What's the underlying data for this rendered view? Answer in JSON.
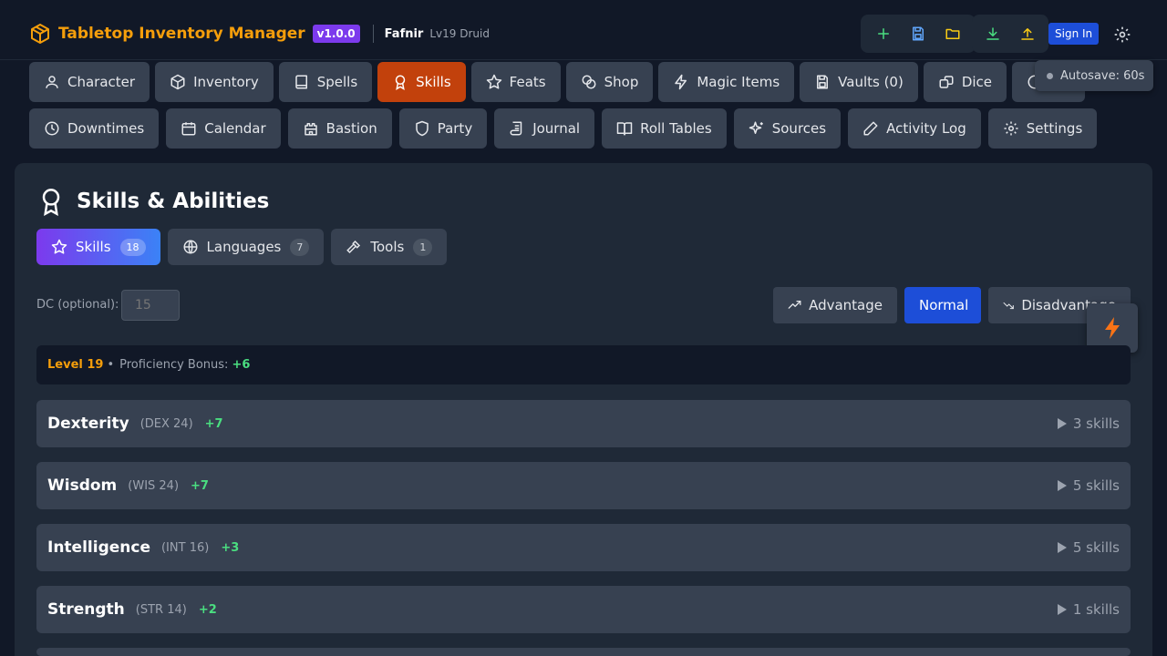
{
  "header": {
    "title": "Tabletop Inventory Manager",
    "version": "v1.0.0",
    "character_name": "Fafnir",
    "character_sub": "Lv19 Druid",
    "sign_in": "Sign In"
  },
  "nav": {
    "row1": [
      {
        "label": "Character",
        "icon": "user-icon"
      },
      {
        "label": "Inventory",
        "icon": "box-icon"
      },
      {
        "label": "Spells",
        "icon": "book-icon"
      },
      {
        "label": "Skills",
        "icon": "award-icon",
        "active": true
      },
      {
        "label": "Feats",
        "icon": "star-icon"
      },
      {
        "label": "Shop",
        "icon": "coins-icon"
      },
      {
        "label": "Magic Items",
        "icon": "zap-icon"
      },
      {
        "label": "Vaults (0)",
        "icon": "save-icon"
      },
      {
        "label": "Dice",
        "icon": "dice-icon"
      }
    ],
    "row2": [
      {
        "label": "Downtimes",
        "icon": "clock-icon"
      },
      {
        "label": "Calendar",
        "icon": "calendar-icon"
      },
      {
        "label": "Bastion",
        "icon": "castle-icon"
      },
      {
        "label": "Party",
        "icon": "shield-icon"
      },
      {
        "label": "Journal",
        "icon": "scroll-icon"
      },
      {
        "label": "Roll Tables",
        "icon": "open-book-icon"
      },
      {
        "label": "Sources",
        "icon": "sparkles-icon"
      },
      {
        "label": "Activity Log",
        "icon": "pencil-icon"
      },
      {
        "label": "Settings",
        "icon": "gear-icon"
      }
    ]
  },
  "autosave": "Autosave: 60s",
  "page": {
    "title": "Skills & Abilities",
    "subtabs": [
      {
        "label": "Skills",
        "count": "18",
        "active": true
      },
      {
        "label": "Languages",
        "count": "7"
      },
      {
        "label": "Tools",
        "count": "1"
      }
    ],
    "dc_label": "DC (optional):",
    "dc_placeholder": "15",
    "roll_modes": {
      "advantage": "Advantage",
      "normal": "Normal",
      "disadvantage": "Disadvantage"
    },
    "info": {
      "level": "Level 19",
      "bullet": "•",
      "pb_label": "Proficiency Bonus:",
      "pb_value": "+6"
    },
    "abilities": [
      {
        "name": "Dexterity",
        "score": "(DEX 24)",
        "mod": "+7",
        "count": "3 skills"
      },
      {
        "name": "Wisdom",
        "score": "(WIS 24)",
        "mod": "+7",
        "count": "5 skills"
      },
      {
        "name": "Intelligence",
        "score": "(INT 16)",
        "mod": "+3",
        "count": "5 skills"
      },
      {
        "name": "Strength",
        "score": "(STR 14)",
        "mod": "+2",
        "count": "1 skills"
      }
    ]
  },
  "colors": {
    "accent": "#f59e0b",
    "active_tab": "#c2410c",
    "primary": "#1d4ed8",
    "positive": "#4ade80"
  }
}
